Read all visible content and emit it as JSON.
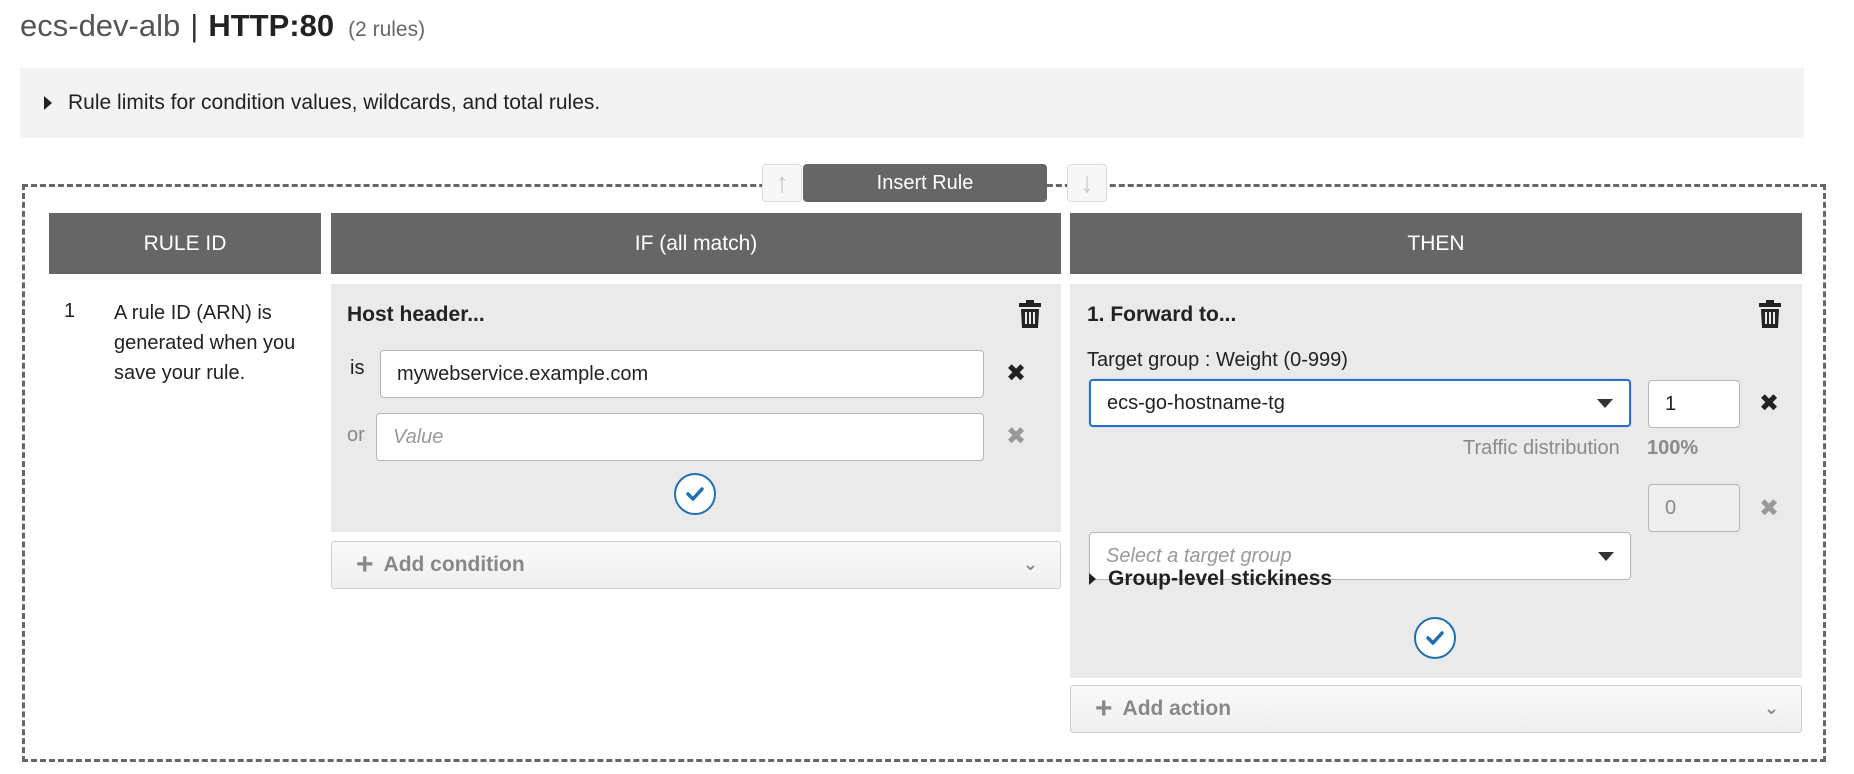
{
  "header": {
    "lb_name": "ecs-dev-alb",
    "separator": "|",
    "listener": "HTTP:80",
    "rules_count": "(2 rules)"
  },
  "info_bar": {
    "label": "Rule limits for condition values, wildcards, and total rules."
  },
  "insert": {
    "label": "Insert Rule",
    "up_icon": "arrow-up-icon",
    "down_icon": "arrow-down-icon"
  },
  "columns": {
    "rule_id": "RULE ID",
    "if": "IF (all match)",
    "then": "THEN"
  },
  "rule": {
    "number": "1",
    "description": "A rule ID (ARN) is generated when you save your rule."
  },
  "condition": {
    "title": "Host header...",
    "is_label": "is",
    "or_label": "or",
    "value": "mywebservice.example.com",
    "placeholder": "Value",
    "add_label": "Add condition"
  },
  "action": {
    "title": "1. Forward to...",
    "target_label": "Target group : Weight (0-999)",
    "target_group": "ecs-go-hostname-tg",
    "weight": "1",
    "traffic_label": "Traffic distribution",
    "traffic_value": "100%",
    "select_placeholder": "Select a target group",
    "weight2": "0",
    "stickiness_label": "Group-level stickiness",
    "add_label": "Add action"
  },
  "colors": {
    "header_bg": "#666666",
    "panel_bg": "#eaeaea",
    "accent": "#1f6fb5",
    "focus": "#2d6ec9"
  }
}
